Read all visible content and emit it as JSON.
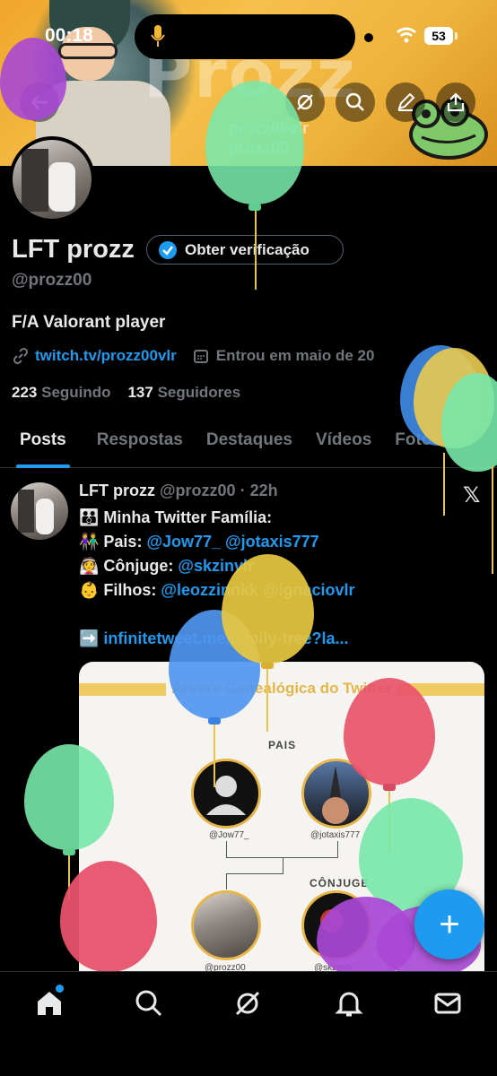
{
  "status_bar": {
    "time": "00:18",
    "battery": "53"
  },
  "banner": {
    "art_text": "Prozz",
    "handle_lines": [
      "prozz00vlr",
      "prozz00"
    ]
  },
  "profile": {
    "name": "LFT prozz",
    "verify_label": "Obter verificação",
    "handle": "@prozz00",
    "bio": "F/A Valorant player",
    "link": "twitch.tv/prozz00vlr",
    "joined": "Entrou em maio de 20",
    "following_count": "223",
    "following_label": "Seguindo",
    "followers_count": "137",
    "followers_label": "Seguidores"
  },
  "tabs": [
    "Posts",
    "Respostas",
    "Destaques",
    "Vídeos",
    "Fotos"
  ],
  "post": {
    "author": "LFT prozz",
    "handle": "@prozz00",
    "time": "22h",
    "line1": "👪 Minha Twitter Família:",
    "line2_label": "👫 Pais: ",
    "line2_mentions": "@Jow77_ @jotaxis777",
    "line3_label": "👰 Cônjuge: ",
    "line3_mention": "@skzinvlr",
    "line4_label": "👶 Filhos: ",
    "line4_mentions": "@leozzinnkk @ignaciovlr",
    "link_prefix": "➡️ ",
    "link": "infinitetweet.me/family-tree?la..."
  },
  "card": {
    "title": "Árvore Genealógica do Twitter",
    "parents_label": "PAIS",
    "spouse_label": "CÔNJUGE",
    "parent1": "@Jow77_",
    "parent2": "@jotaxis777",
    "self": "@prozz00",
    "spouse": "@skzinvlr"
  },
  "fab_label": "+",
  "colors": {
    "accent": "#1d9bf0",
    "background": "#000000",
    "muted": "#71767b"
  }
}
